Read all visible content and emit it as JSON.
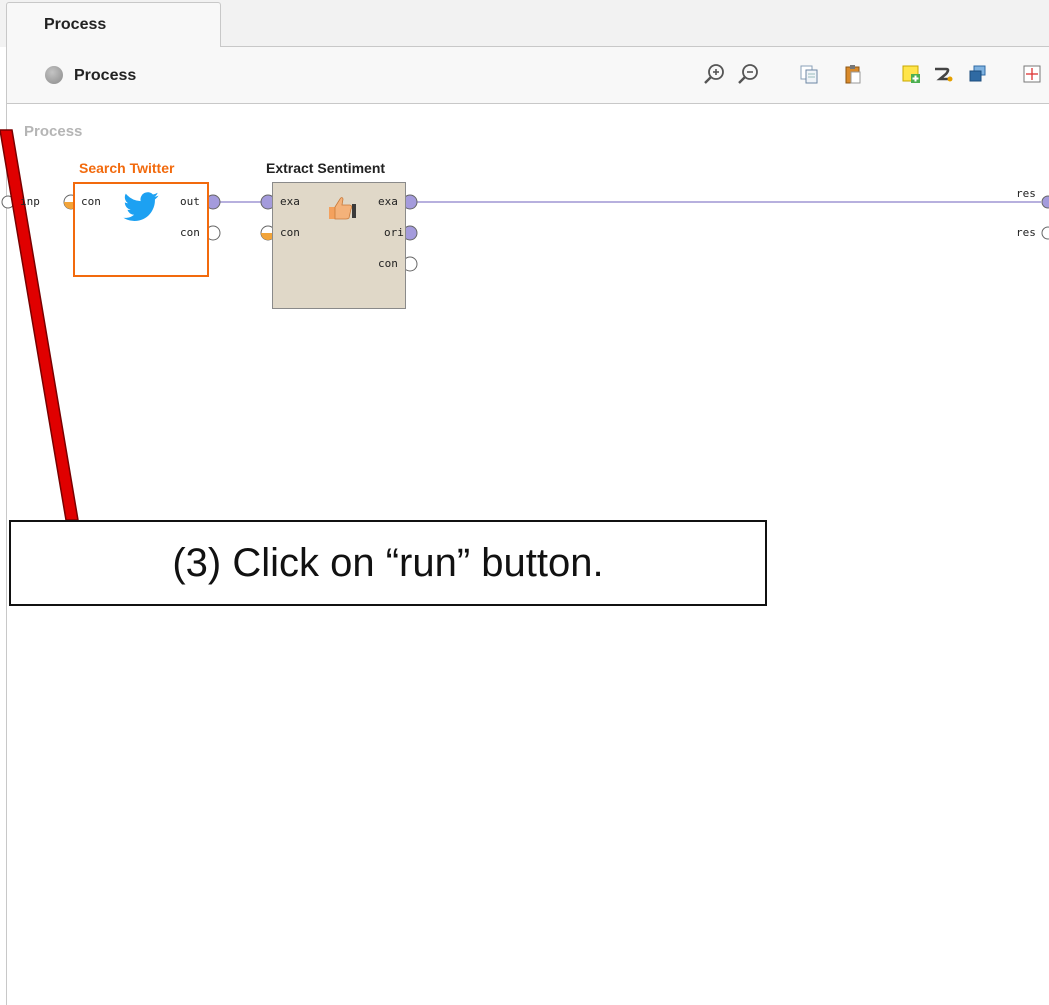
{
  "tab": {
    "label": "Process"
  },
  "breadcrumb": {
    "label": "Process"
  },
  "toolbar": {
    "icons": [
      "zoom-in-icon",
      "zoom-out-icon",
      "copy-icon",
      "paste-icon",
      "add-note-icon",
      "auto-wire-icon",
      "layers-icon",
      "fit-view-icon"
    ]
  },
  "canvas": {
    "label": "Process"
  },
  "process_ports": {
    "input": "inp",
    "result_1": "res",
    "result_2": "res"
  },
  "operators": {
    "search_twitter": {
      "title": "Search Twitter",
      "in_con": "con",
      "out": "out",
      "out_con": "con",
      "icon": "twitter-icon",
      "color": "#f26a0d"
    },
    "extract_sentiment": {
      "title": "Extract Sentiment",
      "in_exa": "exa",
      "in_con": "con",
      "out_exa": "exa",
      "out_ori": "ori",
      "out_con": "con",
      "icon": "thumbs-up-icon"
    }
  },
  "callout": {
    "text": "(3) Click on “run” button."
  },
  "colors": {
    "connection": "#9f96d4",
    "port_purple": "#a49bdc",
    "port_orange": "#f2a43a",
    "annotation_arrow": "#e00000"
  }
}
